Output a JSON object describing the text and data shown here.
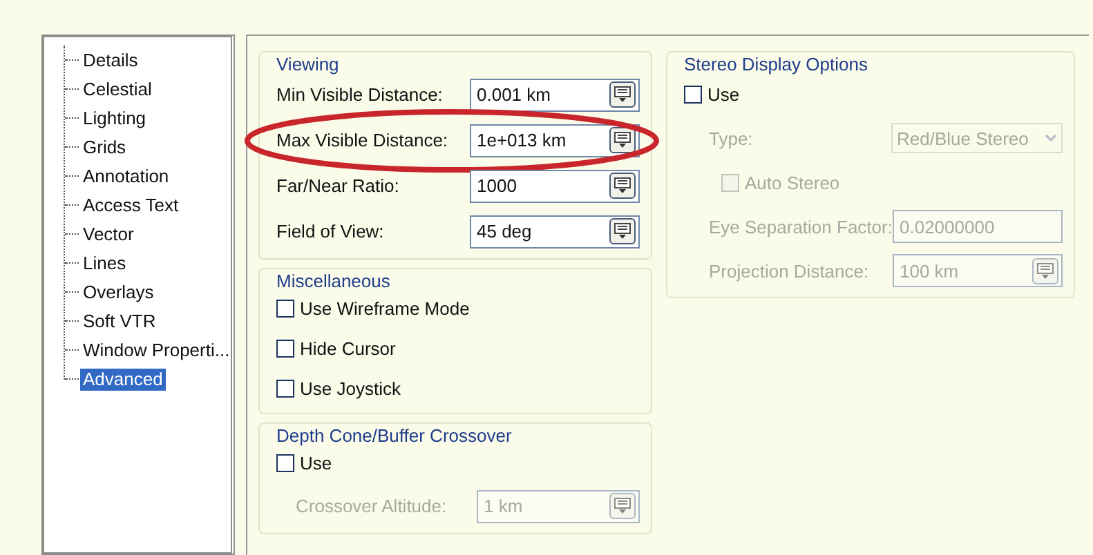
{
  "tree": {
    "items": [
      {
        "label": "Details",
        "selected": false
      },
      {
        "label": "Celestial",
        "selected": false
      },
      {
        "label": "Lighting",
        "selected": false
      },
      {
        "label": "Grids",
        "selected": false
      },
      {
        "label": "Annotation",
        "selected": false
      },
      {
        "label": "Access Text",
        "selected": false
      },
      {
        "label": "Vector",
        "selected": false
      },
      {
        "label": "Lines",
        "selected": false
      },
      {
        "label": "Overlays",
        "selected": false
      },
      {
        "label": "Soft VTR",
        "selected": false
      },
      {
        "label": "Window Properti...",
        "selected": false
      },
      {
        "label": "Advanced",
        "selected": true
      }
    ]
  },
  "columns": [
    {
      "groups": [
        {
          "title": "Viewing",
          "rows": [
            {
              "kind": "field",
              "label": "Min Visible Distance:",
              "value": "0.001 km",
              "spinner": true,
              "disabled": false
            },
            {
              "kind": "field",
              "label": "Max Visible Distance:",
              "value": "1e+013 km",
              "spinner": true,
              "disabled": false,
              "circled": true
            },
            {
              "kind": "field",
              "label": "Far/Near Ratio:",
              "value": "1000",
              "spinner": true,
              "disabled": false
            },
            {
              "kind": "field",
              "label": "Field of View:",
              "value": "45 deg",
              "spinner": true,
              "disabled": false
            }
          ]
        },
        {
          "title": "Miscellaneous",
          "rows": [
            {
              "kind": "checkbox",
              "label": "Use Wireframe Mode",
              "checked": false,
              "disabled": false
            },
            {
              "kind": "checkbox",
              "label": "Hide Cursor",
              "checked": false,
              "disabled": false
            },
            {
              "kind": "checkbox",
              "label": "Use Joystick",
              "checked": false,
              "disabled": false
            }
          ]
        },
        {
          "title": "Depth Cone/Buffer Crossover",
          "rows": [
            {
              "kind": "checkbox",
              "label": "Use",
              "checked": false,
              "disabled": false
            },
            {
              "kind": "field",
              "label": "Crossover Altitude:",
              "value": "1 km",
              "spinner": true,
              "disabled": true
            }
          ]
        }
      ]
    },
    {
      "groups": [
        {
          "title": "Stereo Display Options",
          "rows": [
            {
              "kind": "checkbox",
              "label": "Use",
              "checked": false,
              "disabled": false
            },
            {
              "kind": "dropdown",
              "label": "Type:",
              "value": "Red/Blue Stereo",
              "disabled": true
            },
            {
              "kind": "checkbox",
              "label": "Auto Stereo",
              "checked": false,
              "disabled": true
            },
            {
              "kind": "field",
              "label": "Eye Separation Factor:",
              "value": "0.02000000",
              "spinner": false,
              "disabled": true
            },
            {
              "kind": "field",
              "label": "Projection Distance:",
              "value": "100 km",
              "spinner": true,
              "disabled": true
            }
          ]
        }
      ]
    }
  ]
}
